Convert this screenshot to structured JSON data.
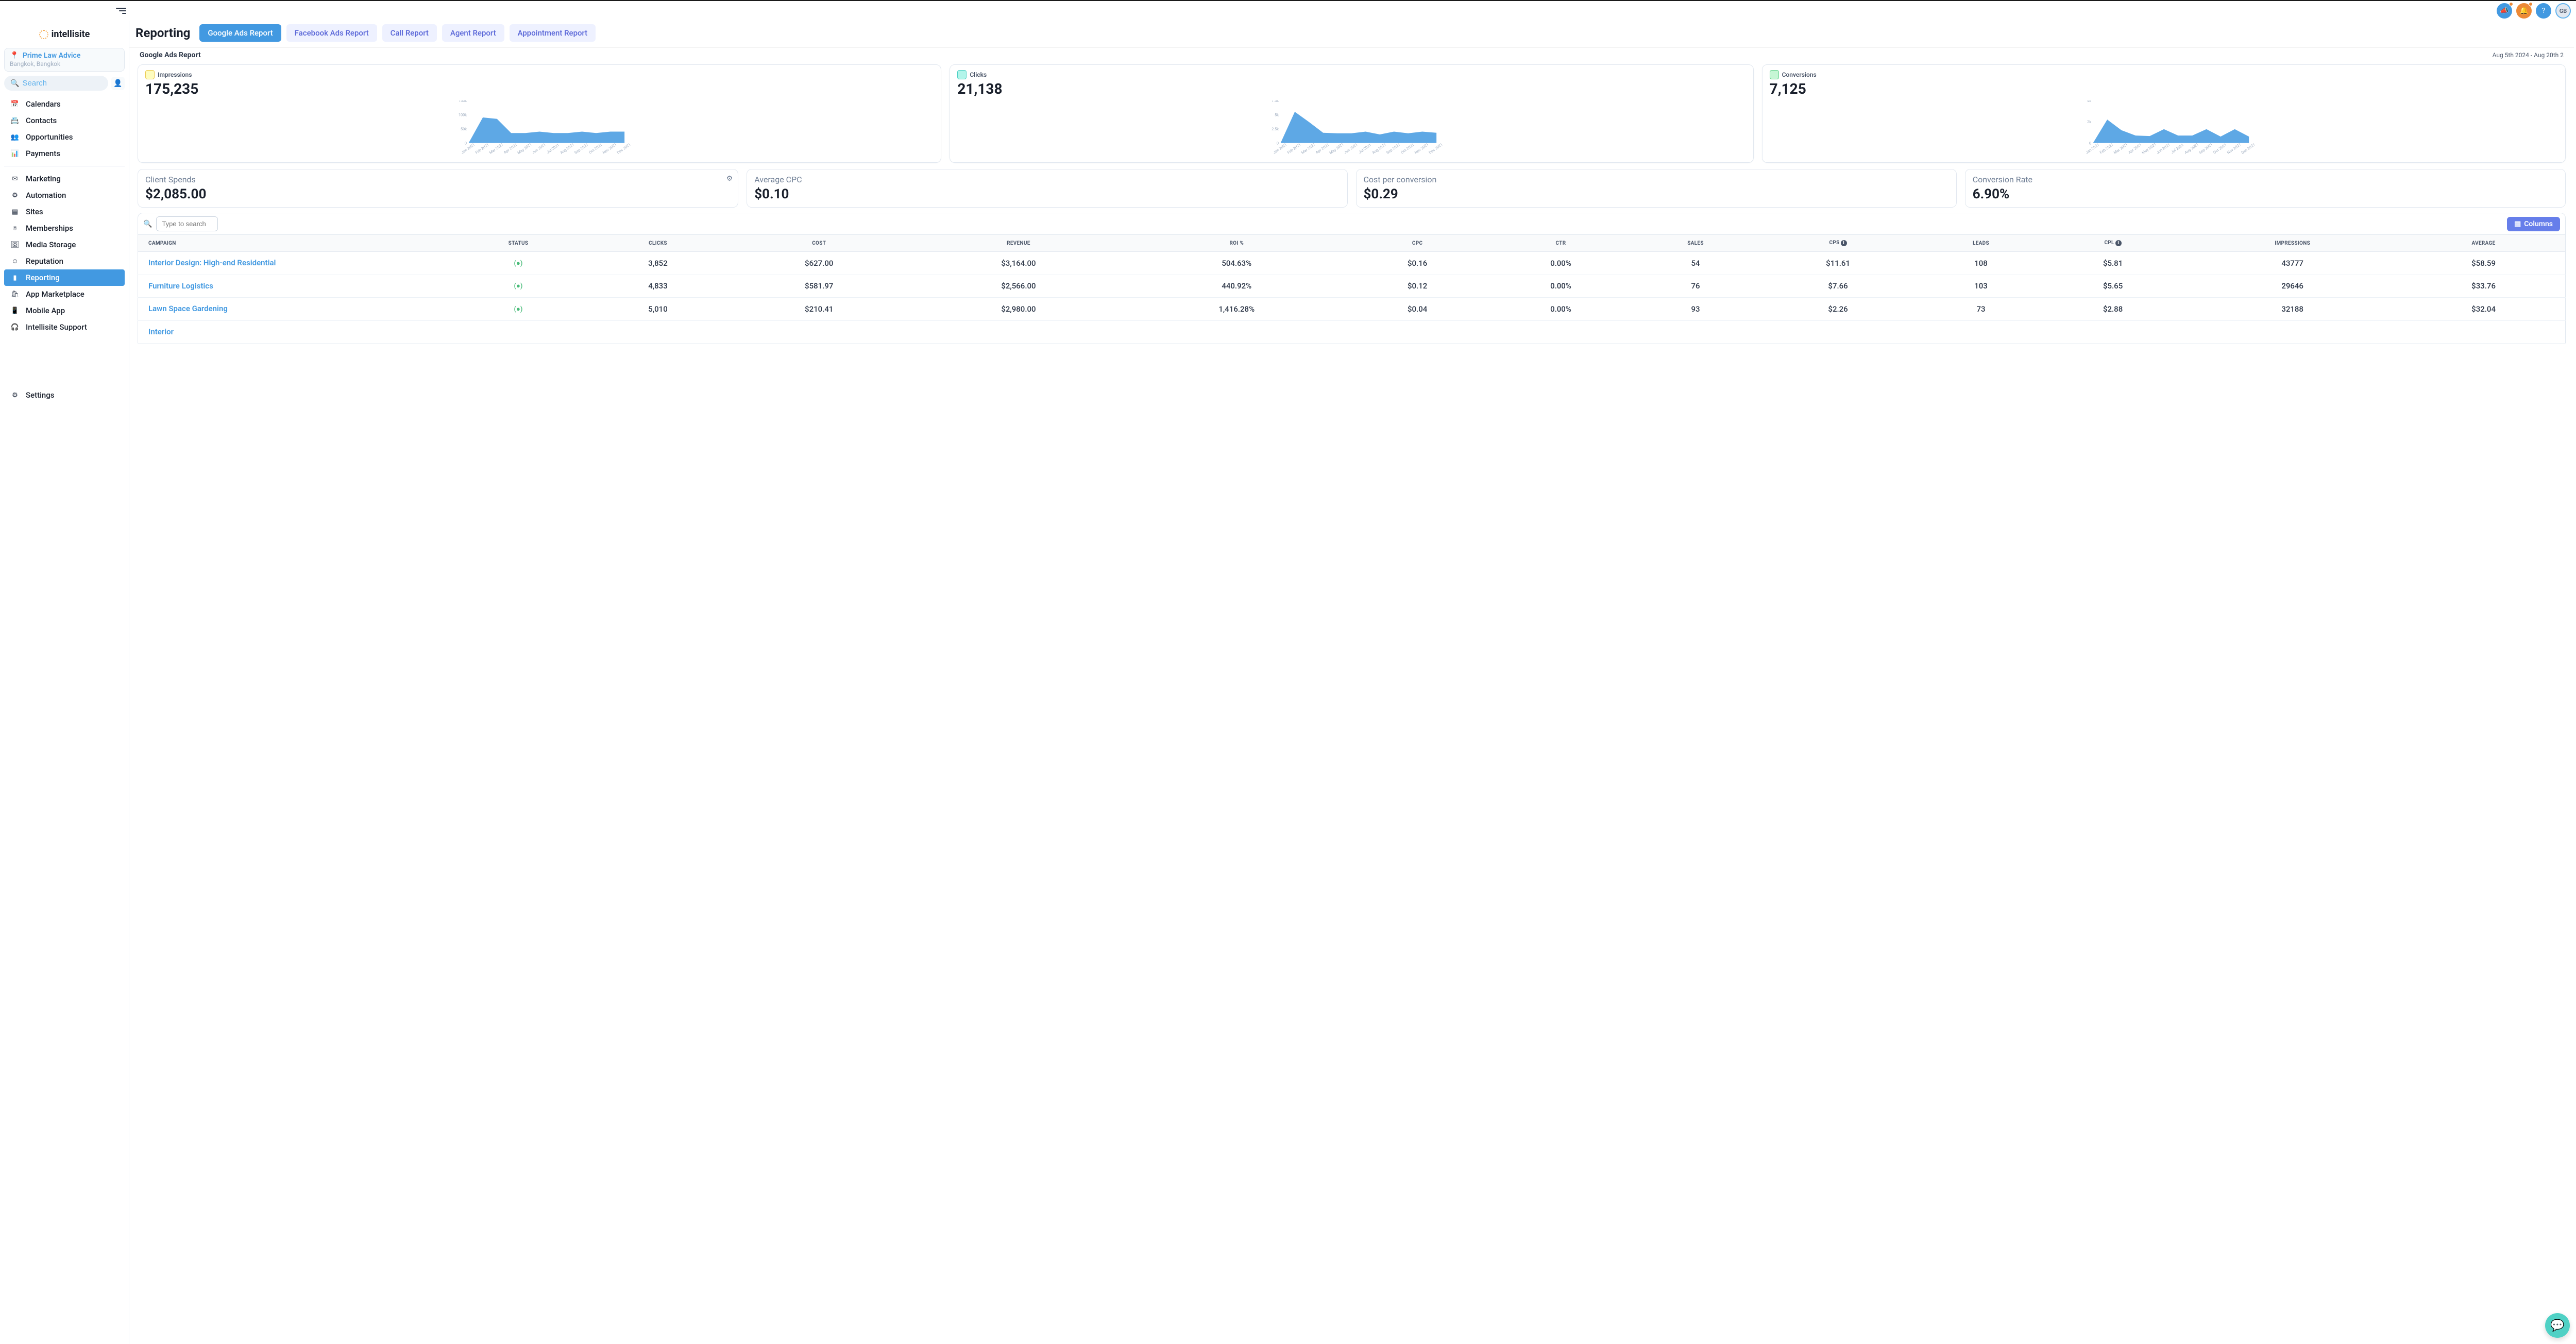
{
  "brand": {
    "name": "intellisite"
  },
  "account": {
    "name": "Prime Law Advice",
    "location": "Bangkok, Bangkok"
  },
  "search": {
    "placeholder": "Search"
  },
  "user": {
    "initials": "GB"
  },
  "sidebar": {
    "groups": [
      [
        {
          "label": "Calendars",
          "icon": "📅"
        },
        {
          "label": "Contacts",
          "icon": "📇"
        },
        {
          "label": "Opportunities",
          "icon": "👥"
        },
        {
          "label": "Payments",
          "icon": "📊"
        }
      ],
      [
        {
          "label": "Marketing",
          "icon": "✉"
        },
        {
          "label": "Automation",
          "icon": "⚙"
        },
        {
          "label": "Sites",
          "icon": "▤"
        },
        {
          "label": "Memberships",
          "icon": "⍟"
        },
        {
          "label": "Media Storage",
          "icon": "🖼"
        },
        {
          "label": "Reputation",
          "icon": "☺"
        },
        {
          "label": "Reporting",
          "icon": "▮",
          "active": true
        },
        {
          "label": "App Marketplace",
          "icon": "🛍"
        },
        {
          "label": "Mobile App",
          "icon": "📱"
        },
        {
          "label": "Intellisite Support",
          "icon": "🎧"
        }
      ]
    ],
    "bottom": [
      {
        "label": "Settings",
        "icon": "⚙"
      }
    ]
  },
  "page": {
    "title": "Reporting",
    "tabs": [
      {
        "label": "Google Ads Report",
        "active": true
      },
      {
        "label": "Facebook Ads Report"
      },
      {
        "label": "Call Report"
      },
      {
        "label": "Agent Report"
      },
      {
        "label": "Appointment Report"
      }
    ],
    "report_name": "Google Ads Report",
    "date_range": "Aug 5th 2024 - Aug 20th 2"
  },
  "chart_data": [
    {
      "type": "area",
      "title": "Impressions",
      "total": "175,235",
      "xlabel": "",
      "ylabel": "",
      "categories": [
        "Jan 2021",
        "Feb 2021",
        "Mar 2021",
        "Apr 2021",
        "May 2021",
        "Jun 2021",
        "Jul 2021",
        "Aug 2021",
        "Sep 2021",
        "Oct 2021",
        "Nov 2021",
        "Dec 2021"
      ],
      "values": [
        0,
        90000,
        85000,
        35000,
        35000,
        40000,
        35000,
        35000,
        40000,
        35000,
        40000,
        40000
      ],
      "ylim": [
        0,
        150000
      ],
      "yticks": [
        "0",
        "50k",
        "100k",
        "150k"
      ],
      "color": "#4299e1"
    },
    {
      "type": "area",
      "title": "Clicks",
      "total": "21,138",
      "categories": [
        "Jan 2021",
        "Feb 2021",
        "Mar 2021",
        "Apr 2021",
        "May 2021",
        "Jun 2021",
        "Jul 2021",
        "Aug 2021",
        "Sep 2021",
        "Oct 2021",
        "Nov 2021",
        "Dec 2021"
      ],
      "values": [
        0,
        5500,
        3700,
        1800,
        1700,
        1700,
        2000,
        1500,
        2000,
        1700,
        2000,
        1800
      ],
      "ylim": [
        0,
        7500
      ],
      "yticks": [
        "0",
        "2.5k",
        "5k",
        "7.5k"
      ],
      "color": "#4299e1"
    },
    {
      "type": "area",
      "title": "Conversions",
      "total": "7,125",
      "categories": [
        "Jan 2021",
        "Feb 2021",
        "Mar 2021",
        "Apr 2021",
        "May 2021",
        "Jun 2021",
        "Jul 2021",
        "Aug 2021",
        "Sep 2021",
        "Oct 2021",
        "Nov 2021",
        "Dec 2021"
      ],
      "values": [
        0,
        2200,
        1200,
        700,
        650,
        1300,
        700,
        700,
        1300,
        600,
        1300,
        600
      ],
      "ylim": [
        0,
        4000
      ],
      "yticks": [
        "0",
        "2k",
        "4k"
      ],
      "color": "#4299e1"
    }
  ],
  "stats": [
    {
      "label": "Client Spends",
      "value": "$2,085.00",
      "gear": true
    },
    {
      "label": "Average CPC",
      "value": "$0.10"
    },
    {
      "label": "Cost per conversion",
      "value": "$0.29"
    },
    {
      "label": "Conversion Rate",
      "value": "6.90%"
    }
  ],
  "table": {
    "search_placeholder": "Type to search",
    "columns_button": "Columns",
    "columns": [
      "CAMPAIGN",
      "STATUS",
      "CLICKS",
      "COST",
      "REVENUE",
      "ROI %",
      "CPC",
      "CTR",
      "SALES",
      "CPS",
      "LEADS",
      "CPL",
      "IMPRESSIONS",
      "AVERAGE"
    ],
    "info_cols": [
      9,
      11
    ],
    "rows": [
      {
        "campaign": "Interior Design: High-end Residential",
        "status": "(●)",
        "clicks": "3,852",
        "cost": "$627.00",
        "revenue": "$3,164.00",
        "roi": "504.63%",
        "cpc": "$0.16",
        "ctr": "0.00%",
        "sales": "54",
        "cps": "$11.61",
        "leads": "108",
        "cpl": "$5.81",
        "impressions": "43777",
        "average": "$58.59"
      },
      {
        "campaign": "Furniture Logistics",
        "status": "(●)",
        "clicks": "4,833",
        "cost": "$581.97",
        "revenue": "$2,566.00",
        "roi": "440.92%",
        "cpc": "$0.12",
        "ctr": "0.00%",
        "sales": "76",
        "cps": "$7.66",
        "leads": "103",
        "cpl": "$5.65",
        "impressions": "29646",
        "average": "$33.76"
      },
      {
        "campaign": "Lawn Space Gardening",
        "status": "(●)",
        "clicks": "5,010",
        "cost": "$210.41",
        "revenue": "$2,980.00",
        "roi": "1,416.28%",
        "cpc": "$0.04",
        "ctr": "0.00%",
        "sales": "93",
        "cps": "$2.26",
        "leads": "73",
        "cpl": "$2.88",
        "impressions": "32188",
        "average": "$32.04"
      },
      {
        "campaign": "Interior",
        "status": "",
        "clicks": "",
        "cost": "",
        "revenue": "",
        "roi": "",
        "cpc": "",
        "ctr": "",
        "sales": "",
        "cps": "",
        "leads": "",
        "cpl": "",
        "impressions": "",
        "average": ""
      }
    ]
  }
}
